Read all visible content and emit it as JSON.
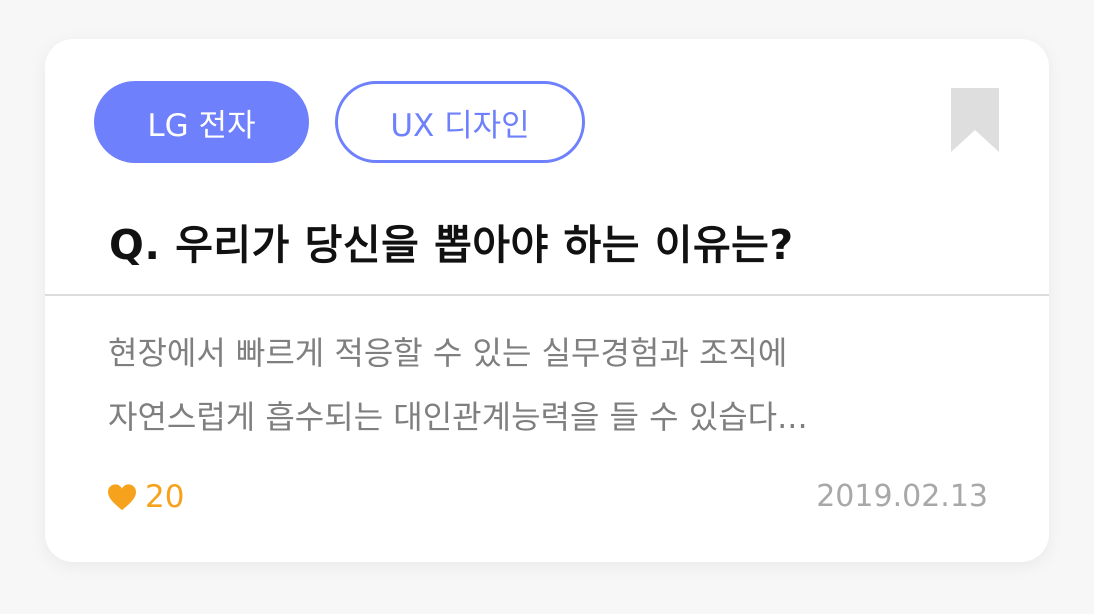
{
  "card": {
    "tags": {
      "company": "LG 전자",
      "role": "UX 디자인"
    },
    "question": "Q. 우리가 당신을 뽑아야 하는 이유는?",
    "answer": {
      "line1": "현장에서 빠르게 적응할 수 있는 실무경험과 조직에",
      "line2": "자연스럽게 흡수되는 대인관계능력을 들 수 있습다..."
    },
    "likes": "20",
    "date": "2019.02.13",
    "icons": {
      "bookmark": "bookmark-icon",
      "heart": "heart-icon"
    },
    "colors": {
      "accent": "#6e80fb",
      "like": "#f7a21c",
      "bookmark": "#dedede"
    }
  }
}
